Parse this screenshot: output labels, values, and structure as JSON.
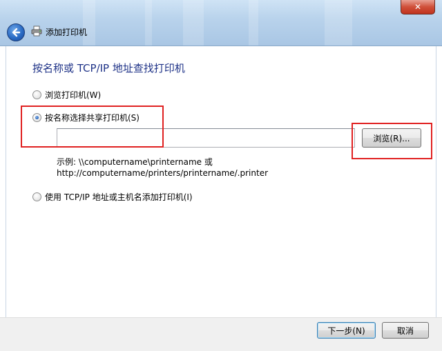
{
  "window": {
    "title": "添加打印机",
    "close_symbol": "✕",
    "titlebar_color": "#b9d3ec",
    "close_color": "#c7402a"
  },
  "icons": {
    "back": "back-arrow-icon",
    "printer": "printer-icon",
    "close": "close-icon"
  },
  "heading": "按名称或 TCP/IP 地址查找打印机",
  "options": {
    "browse": "浏览打印机(W)",
    "by_name": "按名称选择共享打印机(S)",
    "tcp_ip": "使用 TCP/IP 地址或主机名添加打印机(I)",
    "selected": "by_name"
  },
  "name_input": {
    "value": ""
  },
  "browse_button": "浏览(R)...",
  "example": {
    "line1": "示例: \\\\computername\\printername 或",
    "line2": "http://computername/printers/printername/.printer"
  },
  "footer": {
    "next_button": "下一步(N)",
    "cancel_button": "取消"
  },
  "highlight_color": "#e02020"
}
